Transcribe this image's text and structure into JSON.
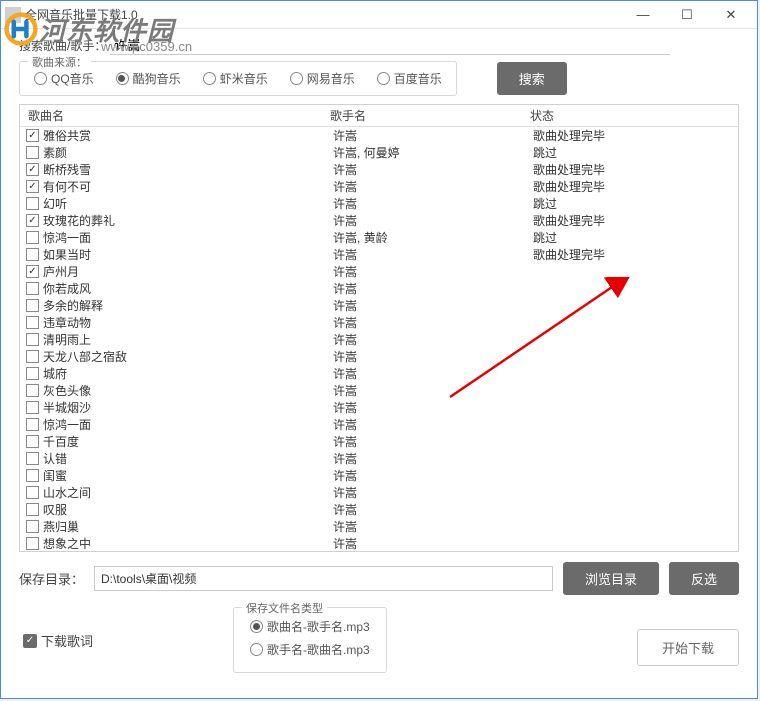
{
  "window": {
    "title": "全网音乐批量下载1.0"
  },
  "logo": {
    "text": "河东软件园",
    "url": "www.pc0359.cn"
  },
  "search": {
    "label": "搜索歌曲/歌手：",
    "value": "许嵩",
    "button": "搜索"
  },
  "source": {
    "label": "歌曲来源：",
    "options": [
      "QQ音乐",
      "酷狗音乐",
      "虾米音乐",
      "网易音乐",
      "百度音乐"
    ],
    "selected": 1
  },
  "columns": {
    "name": "歌曲名",
    "singer": "歌手名",
    "status": "状态"
  },
  "rows": [
    {
      "checked": true,
      "name": "雅俗共赏",
      "singer": "许嵩",
      "status": "歌曲处理完毕"
    },
    {
      "checked": false,
      "name": "素颜",
      "singer": "许嵩, 何曼婷",
      "status": "跳过"
    },
    {
      "checked": true,
      "name": "断桥残雪",
      "singer": "许嵩",
      "status": "歌曲处理完毕"
    },
    {
      "checked": true,
      "name": "有何不可",
      "singer": "许嵩",
      "status": "歌曲处理完毕"
    },
    {
      "checked": false,
      "name": "幻听",
      "singer": "许嵩",
      "status": "跳过"
    },
    {
      "checked": true,
      "name": "玫瑰花的葬礼",
      "singer": "许嵩",
      "status": "歌曲处理完毕"
    },
    {
      "checked": false,
      "name": "惊鸿一面",
      "singer": "许嵩, 黄龄",
      "status": "跳过"
    },
    {
      "checked": false,
      "name": "如果当时",
      "singer": "许嵩",
      "status": "歌曲处理完毕"
    },
    {
      "checked": true,
      "name": "庐州月",
      "singer": "许嵩",
      "status": ""
    },
    {
      "checked": false,
      "name": "你若成风",
      "singer": "许嵩",
      "status": ""
    },
    {
      "checked": false,
      "name": "多余的解释",
      "singer": "许嵩",
      "status": ""
    },
    {
      "checked": false,
      "name": "违章动物",
      "singer": "许嵩",
      "status": ""
    },
    {
      "checked": false,
      "name": "清明雨上",
      "singer": "许嵩",
      "status": ""
    },
    {
      "checked": false,
      "name": "天龙八部之宿敌",
      "singer": "许嵩",
      "status": ""
    },
    {
      "checked": false,
      "name": "城府",
      "singer": "许嵩",
      "status": ""
    },
    {
      "checked": false,
      "name": "灰色头像",
      "singer": "许嵩",
      "status": ""
    },
    {
      "checked": false,
      "name": "半城烟沙",
      "singer": "许嵩",
      "status": ""
    },
    {
      "checked": false,
      "name": "惊鸿一面",
      "singer": "许嵩",
      "status": ""
    },
    {
      "checked": false,
      "name": "千百度",
      "singer": "许嵩",
      "status": ""
    },
    {
      "checked": false,
      "name": "认错",
      "singer": "许嵩",
      "status": ""
    },
    {
      "checked": false,
      "name": "闺蜜",
      "singer": "许嵩",
      "status": ""
    },
    {
      "checked": false,
      "name": "山水之间",
      "singer": "许嵩",
      "status": ""
    },
    {
      "checked": false,
      "name": "叹服",
      "singer": "许嵩",
      "status": ""
    },
    {
      "checked": false,
      "name": "燕归巢",
      "singer": "许嵩",
      "status": ""
    },
    {
      "checked": false,
      "name": "想象之中",
      "singer": "许嵩",
      "status": ""
    }
  ],
  "save": {
    "label": "保存目录：",
    "path": "D:\\tools\\桌面\\视频",
    "browse": "浏览目录",
    "invert": "反选"
  },
  "lyric": {
    "label": "下载歌词"
  },
  "filename": {
    "label": "保存文件名类型",
    "options": [
      "歌曲名-歌手名.mp3",
      "歌手名-歌曲名.mp3"
    ],
    "selected": 0
  },
  "start": "开始下载"
}
